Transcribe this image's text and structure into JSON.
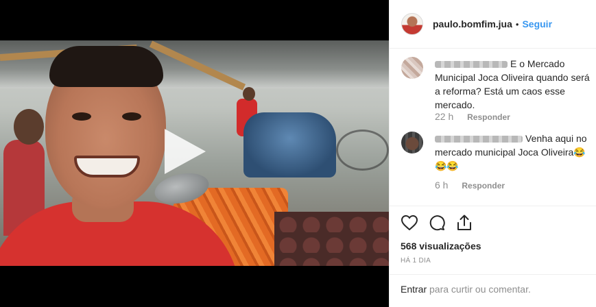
{
  "post": {
    "username": "paulo.bomfim.jua",
    "separator": "•",
    "follow_label": "Seguir"
  },
  "comments": [
    {
      "text": "E o Mercado Municipal Joca Oliveira quando será a reforma? Está um caos esse mercado.",
      "time": "22 h",
      "reply_label": "Responder"
    },
    {
      "text": "Venha aqui no mercado municipal Joca Oliveira😂😂😂",
      "time": "6 h",
      "reply_label": "Responder"
    }
  ],
  "actions": {
    "views": "568 visualizações",
    "date": "HÁ 1 DIA"
  },
  "login": {
    "link_label": "Entrar",
    "rest": " para curtir ou comentar."
  },
  "colors": {
    "accent": "#3897f0",
    "muted": "#8e8e8e",
    "text": "#262626"
  }
}
